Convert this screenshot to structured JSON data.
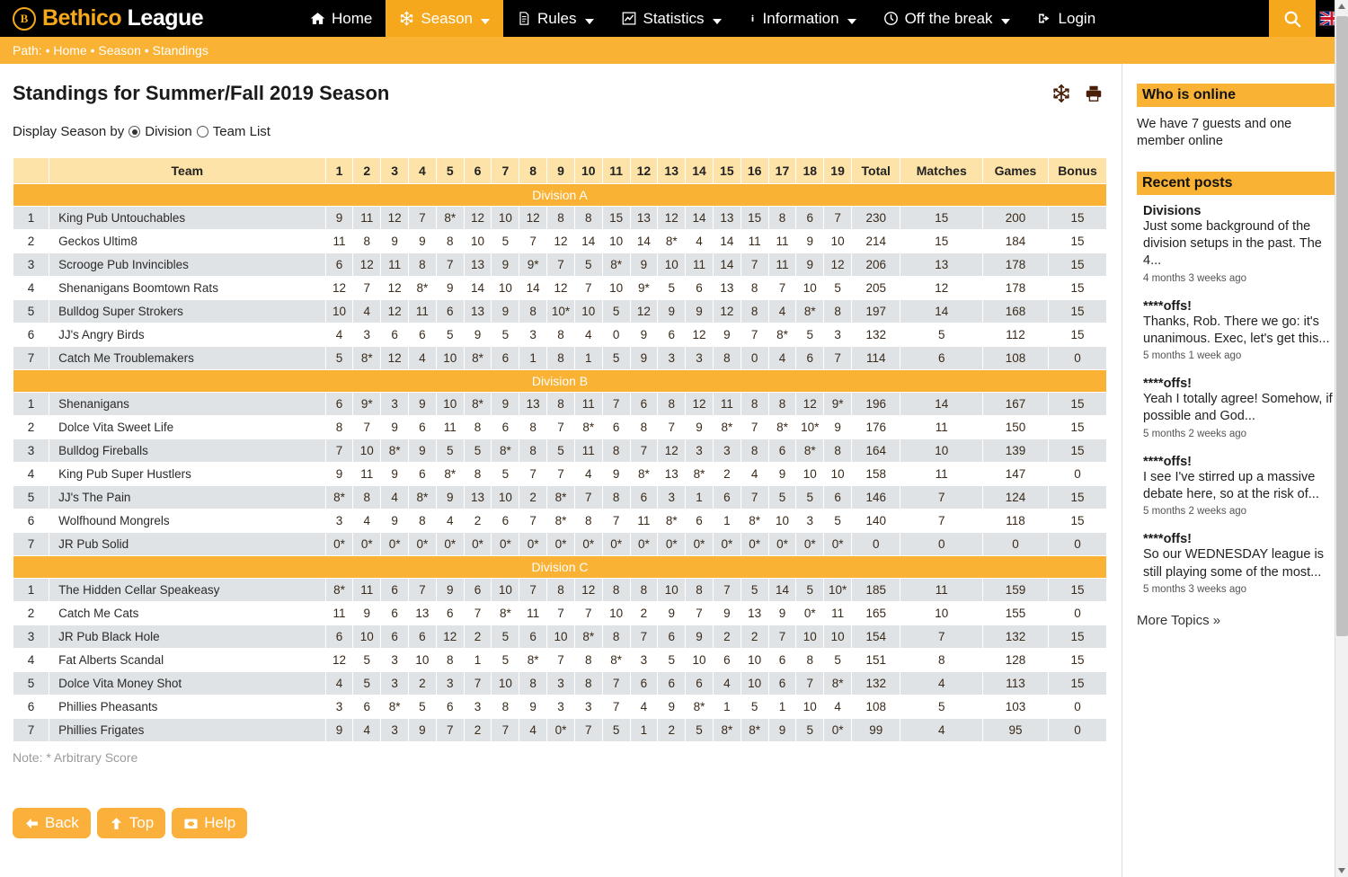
{
  "header": {
    "brand_word1": "Bethico",
    "brand_word2": "League",
    "brand_mark": "B",
    "nav": [
      {
        "label": "Home",
        "icon": "home-icon",
        "caret": false,
        "active": false
      },
      {
        "label": "Season",
        "icon": "snowflake-icon",
        "caret": true,
        "active": true
      },
      {
        "label": "Rules",
        "icon": "document-icon",
        "caret": true,
        "active": false
      },
      {
        "label": "Statistics",
        "icon": "chart-line-icon",
        "caret": true,
        "active": false
      },
      {
        "label": "Information",
        "icon": "info-icon",
        "caret": true,
        "active": false
      },
      {
        "label": "Off the break",
        "icon": "clock-icon",
        "caret": true,
        "active": false
      },
      {
        "label": "Login",
        "icon": "sign-in-icon",
        "caret": false,
        "active": false
      }
    ],
    "search_icon": "search-icon",
    "flag_icon": "uk-flag-icon"
  },
  "breadcrumb": "Path: • Home • Season • Standings",
  "main": {
    "title": "Standings for Summer/Fall 2019 Season",
    "head_icons": [
      "snowflake-icon",
      "printer-icon"
    ],
    "display_by_label": "Display Season by",
    "options": [
      {
        "label": "Division",
        "selected": true
      },
      {
        "label": "Team List",
        "selected": false
      }
    ],
    "note": "Note: * Arbitrary Score",
    "buttons": [
      {
        "label": "Back",
        "icon": "arrow-left-icon"
      },
      {
        "label": "Top",
        "icon": "arrow-up-icon"
      },
      {
        "label": "Help",
        "icon": "first-aid-icon"
      }
    ]
  },
  "table": {
    "columns": {
      "rank": "",
      "team": "Team",
      "weeks": [
        "1",
        "2",
        "3",
        "4",
        "5",
        "6",
        "7",
        "8",
        "9",
        "10",
        "11",
        "12",
        "13",
        "14",
        "15",
        "16",
        "17",
        "18",
        "19"
      ],
      "total": "Total",
      "matches": "Matches",
      "games": "Games",
      "bonus": "Bonus"
    },
    "divisions": [
      {
        "name": "Division A",
        "rows": [
          {
            "rank": "1",
            "team": "King Pub Untouchables",
            "weeks": [
              "9",
              "11",
              "12",
              "7",
              "8*",
              "12",
              "10",
              "12",
              "8",
              "8",
              "15",
              "13",
              "12",
              "14",
              "13",
              "15",
              "8",
              "6",
              "7"
            ],
            "total": "230",
            "matches": "15",
            "games": "200",
            "bonus": "15"
          },
          {
            "rank": "2",
            "team": "Geckos Ultim8",
            "weeks": [
              "11",
              "8",
              "9",
              "9",
              "8",
              "10",
              "5",
              "7",
              "12",
              "14",
              "10",
              "14",
              "8*",
              "4",
              "14",
              "11",
              "11",
              "9",
              "10"
            ],
            "total": "214",
            "matches": "15",
            "games": "184",
            "bonus": "15"
          },
          {
            "rank": "3",
            "team": "Scrooge Pub Invincibles",
            "weeks": [
              "6",
              "12",
              "11",
              "8",
              "7",
              "13",
              "9",
              "9*",
              "7",
              "5",
              "8*",
              "9",
              "10",
              "11",
              "14",
              "7",
              "11",
              "9",
              "12"
            ],
            "total": "206",
            "matches": "13",
            "games": "178",
            "bonus": "15"
          },
          {
            "rank": "4",
            "team": "Shenanigans Boomtown Rats",
            "weeks": [
              "12",
              "7",
              "12",
              "8*",
              "9",
              "14",
              "10",
              "14",
              "12",
              "7",
              "10",
              "9*",
              "5",
              "6",
              "13",
              "8",
              "7",
              "10",
              "5"
            ],
            "total": "205",
            "matches": "12",
            "games": "178",
            "bonus": "15"
          },
          {
            "rank": "5",
            "team": "Bulldog Super Strokers",
            "weeks": [
              "10",
              "4",
              "12",
              "11",
              "6",
              "13",
              "9",
              "8",
              "10*",
              "10",
              "5",
              "12",
              "9",
              "9",
              "12",
              "8",
              "4",
              "8*",
              "8"
            ],
            "total": "197",
            "matches": "14",
            "games": "168",
            "bonus": "15"
          },
          {
            "rank": "6",
            "team": "JJ's Angry Birds",
            "weeks": [
              "4",
              "3",
              "6",
              "6",
              "5",
              "9",
              "5",
              "3",
              "8",
              "4",
              "0",
              "9",
              "6",
              "12",
              "9",
              "7",
              "8*",
              "5",
              "3"
            ],
            "total": "132",
            "matches": "5",
            "games": "112",
            "bonus": "15"
          },
          {
            "rank": "7",
            "team": "Catch Me Troublemakers",
            "weeks": [
              "5",
              "8*",
              "12",
              "4",
              "10",
              "8*",
              "6",
              "1",
              "8",
              "1",
              "5",
              "9",
              "3",
              "3",
              "8",
              "0",
              "4",
              "6",
              "7"
            ],
            "total": "114",
            "matches": "6",
            "games": "108",
            "bonus": "0"
          }
        ]
      },
      {
        "name": "Division B",
        "rows": [
          {
            "rank": "1",
            "team": "Shenanigans",
            "weeks": [
              "6",
              "9*",
              "3",
              "9",
              "10",
              "8*",
              "9",
              "13",
              "8",
              "11",
              "7",
              "6",
              "8",
              "12",
              "11",
              "8",
              "8",
              "12",
              "9*"
            ],
            "total": "196",
            "matches": "14",
            "games": "167",
            "bonus": "15"
          },
          {
            "rank": "2",
            "team": "Dolce Vita Sweet Life",
            "weeks": [
              "8",
              "7",
              "9",
              "6",
              "11",
              "8",
              "6",
              "8",
              "7",
              "8*",
              "6",
              "8",
              "7",
              "9",
              "8*",
              "7",
              "8*",
              "10*",
              "9"
            ],
            "total": "176",
            "matches": "11",
            "games": "150",
            "bonus": "15"
          },
          {
            "rank": "3",
            "team": "Bulldog Fireballs",
            "weeks": [
              "7",
              "10",
              "8*",
              "9",
              "5",
              "5",
              "8*",
              "8",
              "5",
              "11",
              "8",
              "7",
              "12",
              "3",
              "3",
              "8",
              "6",
              "8*",
              "8"
            ],
            "total": "164",
            "matches": "10",
            "games": "139",
            "bonus": "15"
          },
          {
            "rank": "4",
            "team": "King Pub Super Hustlers",
            "weeks": [
              "9",
              "11",
              "9",
              "6",
              "8*",
              "8",
              "5",
              "7",
              "7",
              "4",
              "9",
              "8*",
              "13",
              "8*",
              "2",
              "4",
              "9",
              "10",
              "10"
            ],
            "total": "158",
            "matches": "11",
            "games": "147",
            "bonus": "0"
          },
          {
            "rank": "5",
            "team": "JJ's The Pain",
            "weeks": [
              "8*",
              "8",
              "4",
              "8*",
              "9",
              "13",
              "10",
              "2",
              "8*",
              "7",
              "8",
              "6",
              "3",
              "1",
              "6",
              "7",
              "5",
              "5",
              "6"
            ],
            "total": "146",
            "matches": "7",
            "games": "124",
            "bonus": "15"
          },
          {
            "rank": "6",
            "team": "Wolfhound Mongrels",
            "weeks": [
              "3",
              "4",
              "9",
              "8",
              "4",
              "2",
              "6",
              "7",
              "8*",
              "8",
              "7",
              "11",
              "8*",
              "6",
              "1",
              "8*",
              "10",
              "3",
              "5"
            ],
            "total": "140",
            "matches": "7",
            "games": "118",
            "bonus": "15"
          },
          {
            "rank": "7",
            "team": "JR Pub Solid",
            "weeks": [
              "0*",
              "0*",
              "0*",
              "0*",
              "0*",
              "0*",
              "0*",
              "0*",
              "0*",
              "0*",
              "0*",
              "0*",
              "0*",
              "0*",
              "0*",
              "0*",
              "0*",
              "0*",
              "0*"
            ],
            "total": "0",
            "matches": "0",
            "games": "0",
            "bonus": "0"
          }
        ]
      },
      {
        "name": "Division C",
        "rows": [
          {
            "rank": "1",
            "team": "The Hidden Cellar Speakeasy",
            "weeks": [
              "8*",
              "11",
              "6",
              "7",
              "9",
              "6",
              "10",
              "7",
              "8",
              "12",
              "8",
              "8",
              "10",
              "8",
              "7",
              "5",
              "14",
              "5",
              "10*"
            ],
            "total": "185",
            "matches": "11",
            "games": "159",
            "bonus": "15"
          },
          {
            "rank": "2",
            "team": "Catch Me Cats",
            "weeks": [
              "11",
              "9",
              "6",
              "13",
              "6",
              "7",
              "8*",
              "11",
              "7",
              "7",
              "10",
              "2",
              "9",
              "7",
              "9",
              "13",
              "9",
              "0*",
              "11"
            ],
            "total": "165",
            "matches": "10",
            "games": "155",
            "bonus": "0"
          },
          {
            "rank": "3",
            "team": "JR Pub Black Hole",
            "weeks": [
              "6",
              "10",
              "6",
              "6",
              "12",
              "2",
              "5",
              "6",
              "10",
              "8*",
              "8",
              "7",
              "6",
              "9",
              "2",
              "2",
              "7",
              "10",
              "10"
            ],
            "total": "154",
            "matches": "7",
            "games": "132",
            "bonus": "15"
          },
          {
            "rank": "4",
            "team": "Fat Alberts Scandal",
            "weeks": [
              "12",
              "5",
              "3",
              "10",
              "8",
              "1",
              "5",
              "8*",
              "7",
              "8",
              "8*",
              "3",
              "5",
              "10",
              "6",
              "10",
              "6",
              "8",
              "5"
            ],
            "total": "151",
            "matches": "8",
            "games": "128",
            "bonus": "15"
          },
          {
            "rank": "5",
            "team": "Dolce Vita Money Shot",
            "weeks": [
              "4",
              "5",
              "3",
              "2",
              "3",
              "7",
              "10",
              "8",
              "3",
              "8",
              "7",
              "6",
              "6",
              "6",
              "4",
              "10",
              "6",
              "7",
              "8*"
            ],
            "total": "132",
            "matches": "4",
            "games": "113",
            "bonus": "15"
          },
          {
            "rank": "6",
            "team": "Phillies Pheasants",
            "weeks": [
              "3",
              "6",
              "8*",
              "5",
              "6",
              "3",
              "8",
              "9",
              "3",
              "3",
              "7",
              "4",
              "9",
              "8*",
              "1",
              "5",
              "1",
              "10",
              "4"
            ],
            "total": "108",
            "matches": "5",
            "games": "103",
            "bonus": "0"
          },
          {
            "rank": "7",
            "team": "Phillies Frigates",
            "weeks": [
              "9",
              "4",
              "3",
              "9",
              "7",
              "2",
              "7",
              "4",
              "0*",
              "7",
              "5",
              "1",
              "2",
              "5",
              "8*",
              "8*",
              "9",
              "5",
              "0*"
            ],
            "total": "99",
            "matches": "4",
            "games": "95",
            "bonus": "0"
          }
        ]
      }
    ]
  },
  "sidebar": {
    "who_online_title": "Who is online",
    "who_online_text": "We have 7 guests and one member online",
    "recent_posts_title": "Recent posts",
    "posts": [
      {
        "title": "Divisions",
        "body": "Just some background of the division setups in the past. The 4...",
        "time": "4 months 3 weeks ago"
      },
      {
        "title": "****offs!",
        "body": "Thanks, Rob. There we go: it's unanimous. Exec, let's get this...",
        "time": "5 months 1 week ago"
      },
      {
        "title": "****offs!",
        "body": "Yeah I totally agree! Somehow, if possible and God...",
        "time": "5 months 2 weeks ago"
      },
      {
        "title": "****offs!",
        "body": "I see I've stirred up a massive debate here, so at the risk of...",
        "time": "5 months 2 weeks ago"
      },
      {
        "title": "****offs!",
        "body": "So our WEDNESDAY league is still playing some of the most...",
        "time": "5 months 3 weeks ago"
      }
    ],
    "more_topics": "More Topics »"
  },
  "colors": {
    "brand_orange": "#f5a81c",
    "header_black": "#000000",
    "division_bar": "#f9b233",
    "table_header": "#fde3a7",
    "row_shade": "#dfe3e6"
  }
}
